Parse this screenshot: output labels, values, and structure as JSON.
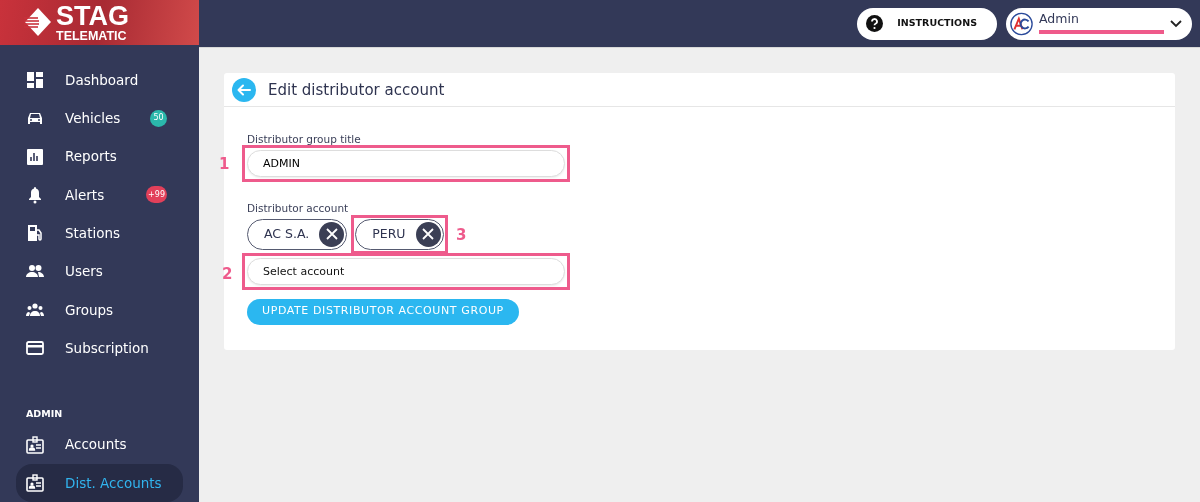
{
  "brand": {
    "name": "STAG",
    "tagline": "TELEMATIC"
  },
  "header": {
    "instructions_button": "INSTRUCTIONS",
    "user": {
      "name": "Admin",
      "email_redacted": true
    }
  },
  "sidebar": {
    "items": [
      {
        "label": "Dashboard",
        "selected": false
      },
      {
        "label": "Vehicles",
        "selected": false,
        "badge": "50",
        "color": "#2bb8ab"
      },
      {
        "label": "Reports",
        "selected": false
      },
      {
        "label": "Alerts",
        "selected": false,
        "badge": "+99",
        "color": "#e2405a"
      },
      {
        "label": "Stations",
        "selected": false
      },
      {
        "label": "Users",
        "selected": false
      },
      {
        "label": "Groups",
        "selected": false
      },
      {
        "label": "Subscription",
        "selected": false
      }
    ],
    "section_heading": "ADMIN",
    "admin_items": [
      {
        "label": "Accounts",
        "selected": false
      },
      {
        "label": "Dist. Accounts",
        "selected": true
      }
    ]
  },
  "page": {
    "title": "Edit distributor account",
    "title_field": {
      "label": "Distributor group title",
      "value": "ADMIN",
      "annotation": "1"
    },
    "account_field": {
      "label": "Distributor account",
      "chips": [
        {
          "text": "AC S.A."
        },
        {
          "text": "PERU",
          "annotation": "3"
        }
      ],
      "placeholder": "Select account",
      "annotation": "2"
    },
    "submit_button": "UPDATE DISTRIBUTOR ACCOUNT GROUP"
  }
}
